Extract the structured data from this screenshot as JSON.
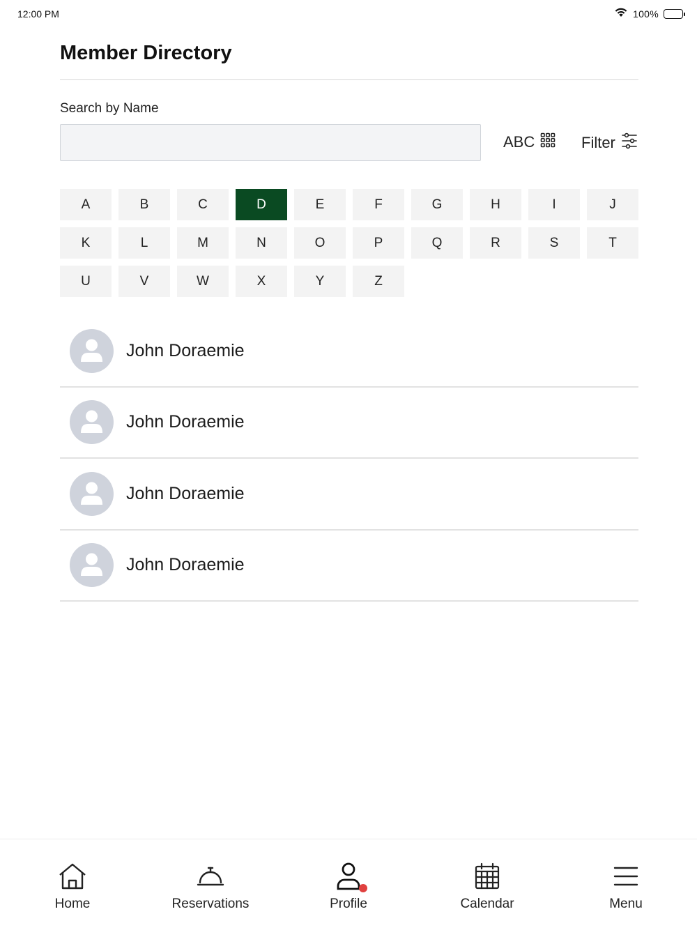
{
  "status_bar": {
    "time": "12:00 PM",
    "battery": "100%"
  },
  "header": {
    "title": "Member Directory"
  },
  "search": {
    "label": "Search by Name",
    "placeholder": "",
    "value": ""
  },
  "view_toggle": {
    "label": "ABC",
    "icon": "grid-icon"
  },
  "filter": {
    "label": "Filter",
    "icon": "sliders-icon"
  },
  "alphabet": {
    "letters": [
      "A",
      "B",
      "C",
      "D",
      "E",
      "F",
      "G",
      "H",
      "I",
      "J",
      "K",
      "L",
      "M",
      "N",
      "O",
      "P",
      "Q",
      "R",
      "S",
      "T",
      "U",
      "V",
      "W",
      "X",
      "Y",
      "Z"
    ],
    "selected": "D"
  },
  "members": [
    {
      "name": "John Doraemie",
      "avatar": "person-icon"
    },
    {
      "name": "John Doraemie",
      "avatar": "person-icon"
    },
    {
      "name": "John Doraemie",
      "avatar": "person-icon"
    },
    {
      "name": "John Doraemie",
      "avatar": "person-icon"
    }
  ],
  "nav": {
    "items": [
      {
        "label": "Home",
        "icon": "home-icon"
      },
      {
        "label": "Reservations",
        "icon": "service-bell-icon"
      },
      {
        "label": "Profile",
        "icon": "profile-icon",
        "badge": true
      },
      {
        "label": "Calendar",
        "icon": "calendar-icon"
      },
      {
        "label": "Menu",
        "icon": "hamburger-icon"
      }
    ]
  },
  "colors": {
    "accent": "#0a4a22",
    "badge": "#e0413f",
    "avatar_bg": "#cfd3dc"
  }
}
